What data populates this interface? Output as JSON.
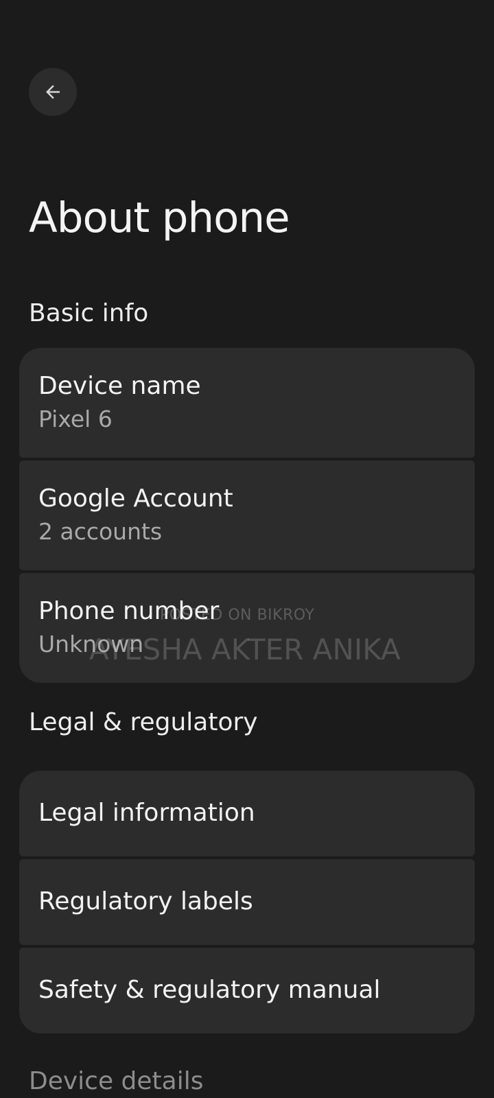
{
  "header": {
    "back_icon": "arrow-left-icon",
    "title": "About phone"
  },
  "sections": {
    "basic_info": {
      "label": "Basic info",
      "items": [
        {
          "title": "Device name",
          "subtitle": "Pixel 6"
        },
        {
          "title": "Google Account",
          "subtitle": "2 accounts"
        },
        {
          "title": "Phone number",
          "subtitle": "Unknown"
        }
      ]
    },
    "legal": {
      "label": "Legal & regulatory",
      "items": [
        {
          "title": "Legal information"
        },
        {
          "title": "Regulatory labels"
        },
        {
          "title": "Safety & regulatory manual"
        }
      ]
    },
    "device_details": {
      "label": "Device details"
    }
  },
  "watermark": {
    "line1": "POSTED ON BIKROY",
    "line2": "AYESHA AKTER ANIKA"
  },
  "colors": {
    "background": "#1b1b1b",
    "card": "#2c2c2c",
    "primary_text": "#f3f3f3",
    "secondary_text": "#a9a9a9"
  }
}
